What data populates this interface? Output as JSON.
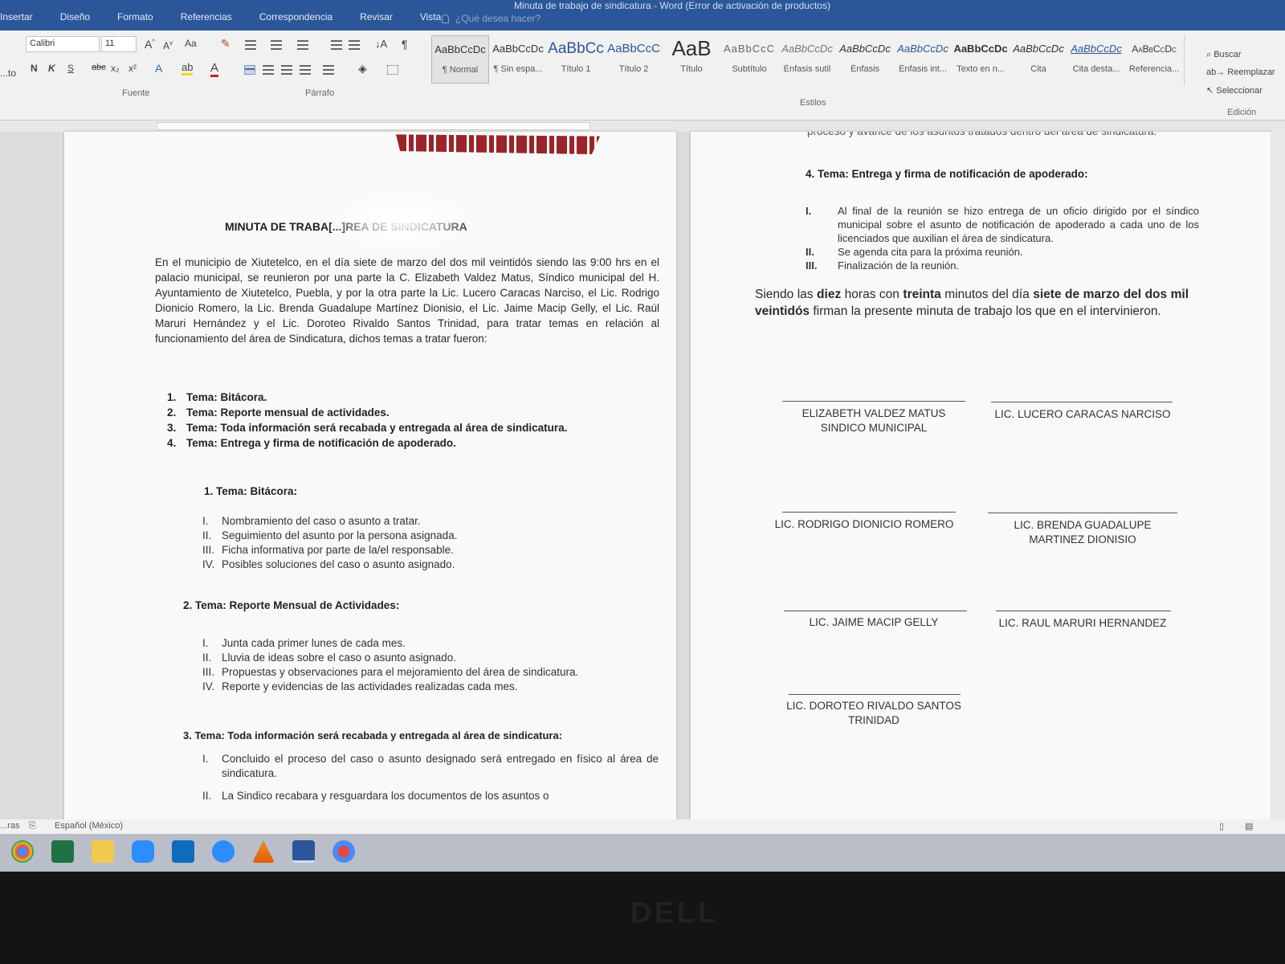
{
  "window": {
    "title": "Minuta de trabajo de sindicatura - Word (Error de activación de productos)"
  },
  "ribbon_tabs": [
    "Insertar",
    "Diseño",
    "Formato",
    "Referencias",
    "Correspondencia",
    "Revisar",
    "Vista"
  ],
  "tell_me": "¿Qué desea hacer?",
  "font": {
    "name": "Calibri",
    "size": "11",
    "group_label": "Fuente",
    "buttons": [
      "N",
      "K",
      "S",
      "abc",
      "x₂",
      "x²"
    ],
    "case_button": "Aa"
  },
  "paragraph": {
    "group_label": "Párrafo"
  },
  "clipboard_label": "...to",
  "styles": {
    "group_label": "Estilos",
    "items": [
      {
        "sample": "AaBbCcDc",
        "name": "¶ Normal"
      },
      {
        "sample": "AaBbCcDc",
        "name": "¶ Sin espa..."
      },
      {
        "sample": "AaBbCc",
        "name": "Título 1"
      },
      {
        "sample": "AaBbCcC",
        "name": "Título 2"
      },
      {
        "sample": "AaB",
        "name": "Título"
      },
      {
        "sample": "AaBbCcC",
        "name": "Subtítulo"
      },
      {
        "sample": "AaBbCcDc",
        "name": "Énfasis sutil"
      },
      {
        "sample": "AaBbCcDc",
        "name": "Énfasis"
      },
      {
        "sample": "AaBbCcDc",
        "name": "Énfasis int..."
      },
      {
        "sample": "AaBbCcDc",
        "name": "Texto en n..."
      },
      {
        "sample": "AaBbCcDc",
        "name": "Cita"
      },
      {
        "sample": "AaBbCcDc",
        "name": "Cita desta..."
      },
      {
        "sample": "AaBbCcDc",
        "name": "Referencia..."
      }
    ]
  },
  "editing": {
    "group_label": "Edición",
    "find": "Buscar",
    "replace": "Reemplazar",
    "select": "Seleccionar"
  },
  "document": {
    "title": "MINUTA DE TRABA[...]REA DE SINDICATURA",
    "intro": "En el municipio de Xiutetelco, en el día siete de marzo del dos mil veintidós siendo las 9:00 hrs en el palacio municipal, se reunieron por una parte la C. Elizabeth Valdez Matus, Síndico municipal del H. Ayuntamiento de Xiutetelco, Puebla, y por la otra parte la Lic. Lucero Caracas Narciso, el Lic. Rodrigo Dionicio Romero, la Lic. Brenda Guadalupe Martínez Dionisio, el Lic. Jaime Macip Gelly, el Lic. Raúl Maruri Hernández y el Lic. Doroteo Rivaldo Santos Trinidad, para tratar temas en relación al funcionamiento del área de Sindicatura, dichos temas a tratar fueron:",
    "topics": [
      {
        "num": "1.",
        "text": "Tema: Bitácora."
      },
      {
        "num": "2.",
        "text": "Tema: Reporte mensual de actividades."
      },
      {
        "num": "3.",
        "text": "Tema: Toda información será recabada y entregada al área de sindicatura."
      },
      {
        "num": "4.",
        "text": "Tema: Entrega y firma de notificación de apoderado."
      }
    ],
    "section1": {
      "heading": "1.  Tema: Bitácora:",
      "items": [
        {
          "num": "I.",
          "text": "Nombramiento del caso o asunto a tratar."
        },
        {
          "num": "II.",
          "text": "Seguimiento del asunto por la persona asignada."
        },
        {
          "num": "III.",
          "text": "Ficha informativa por parte de la/el responsable."
        },
        {
          "num": "IV.",
          "text": "Posibles soluciones del caso o asunto asignado."
        }
      ]
    },
    "section2": {
      "heading": "2. Tema: Reporte Mensual de Actividades:",
      "items": [
        {
          "num": "I.",
          "text": "Junta cada primer lunes de cada mes."
        },
        {
          "num": "II.",
          "text": "Lluvia de ideas sobre el caso o asunto asignado."
        },
        {
          "num": "III.",
          "text": "Propuestas y observaciones para el mejoramiento del área de sindicatura."
        },
        {
          "num": "IV.",
          "text": "Reporte y evidencias de las actividades realizadas cada mes."
        }
      ]
    },
    "section3": {
      "heading": "3. Tema: Toda información será recabada y entregada al área de   sindicatura:",
      "items": [
        {
          "num": "I.",
          "text": "Concluido el proceso del caso o asunto designado será entregado en físico al área de sindicatura."
        },
        {
          "num": "II.",
          "text": "La Sindico recabara y resguardara los documentos de los asuntos o"
        }
      ]
    },
    "page2_top": "proceso y avance de los asuntos tratados dentro del área de sindicatura.",
    "section4": {
      "heading": "4. Tema: Entrega y firma de notificación de apoderado:",
      "items": [
        {
          "num": "I.",
          "text": "Al final de la reunión se hizo entrega de un oficio dirigido por el síndico municipal sobre el asunto de notificación de apoderado a cada uno de los licenciados que auxilian el área de sindicatura."
        },
        {
          "num": "II.",
          "text": "Se agenda cita para la próxima reunión."
        },
        {
          "num": "III.",
          "text": "Finalización de la reunión."
        }
      ]
    },
    "closing": {
      "p1": "Siendo las ",
      "b1": "diez",
      "p2": " horas con ",
      "b2": "treinta",
      "p3": " minutos del día ",
      "b3": "siete de marzo del dos mil veintidós",
      "p4": " firman la presente minuta de trabajo los que en el intervinieron."
    },
    "signatures": [
      {
        "line1": "ELIZABETH VALDEZ MATUS",
        "line2": "SINDICO MUNICIPAL"
      },
      {
        "line1": "LIC. LUCERO CARACAS NARCISO",
        "line2": ""
      },
      {
        "line1": "LIC. RODRIGO DIONICIO ROMERO",
        "line2": ""
      },
      {
        "line1": "LIC. BRENDA GUADALUPE",
        "line2": "MARTINEZ DIONISIO"
      },
      {
        "line1": "LIC. JAIME MACIP GELLY",
        "line2": ""
      },
      {
        "line1": "LIC. RAUL MARURI HERNANDEZ",
        "line2": ""
      },
      {
        "line1": "LIC. DOROTEO RIVALDO SANTOS",
        "line2": "TRINIDAD"
      }
    ]
  },
  "status": {
    "words_label": "...ras",
    "language": "Español (México)"
  },
  "taskbar": {
    "apps": [
      "chrome-icon",
      "excel-icon",
      "file-explorer-icon",
      "zoom-icon",
      "outlook-icon",
      "meet-icon",
      "vlc-icon",
      "word-icon",
      "chrome-profile-icon"
    ]
  },
  "monitor_brand": "DELL",
  "colors": {
    "word_blue": "#2b579a",
    "banner_red": "#9b2429"
  }
}
